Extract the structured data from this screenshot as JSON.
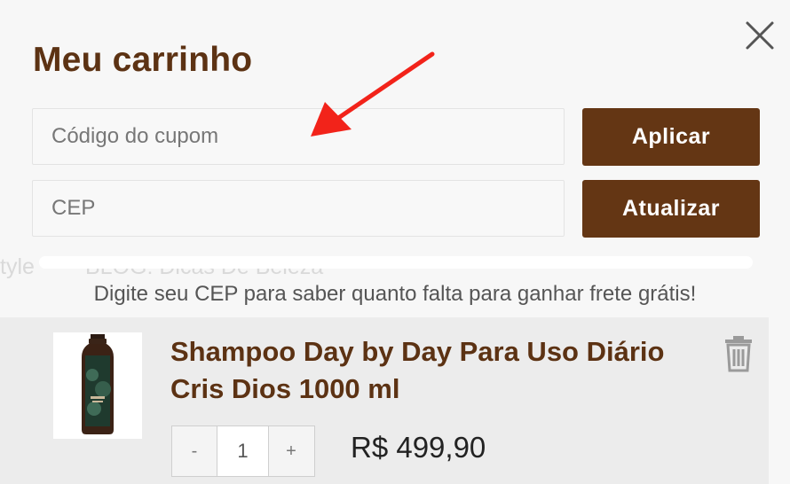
{
  "cart": {
    "title": "Meu carrinho",
    "coupon": {
      "placeholder": "Código do cupom",
      "button": "Aplicar"
    },
    "zip": {
      "placeholder": "CEP",
      "button": "Atualizar"
    },
    "shipping_progress": 0,
    "shipping_message": "Digite seu CEP para saber quanto falta para ganhar frete grátis!",
    "background_text": [
      "tyle",
      "BLOG: Dicas De Beleza"
    ]
  },
  "item": {
    "name": "Shampoo Day by Day Para Uso Diário Cris Dios 1000 ml",
    "quantity": "1",
    "decrement": "-",
    "increment": "+",
    "price": "R$ 499,90"
  },
  "icons": {
    "close": "close-icon",
    "trash": "trash-icon",
    "arrow": "annotation-arrow"
  },
  "colors": {
    "brand": "#5c3213",
    "button": "#643614",
    "arrow": "#f2231a"
  }
}
